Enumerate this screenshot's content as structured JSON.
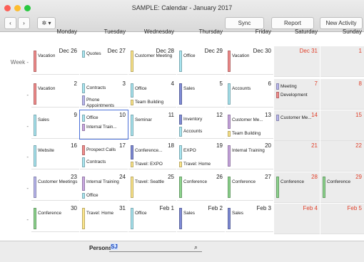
{
  "title": "SAMPLE: Calendar - January 2017",
  "toolbar": {
    "sync": "Sync",
    "report": "Report",
    "new_activity": "New Activity"
  },
  "week_label": "Week -",
  "days": [
    "Monday",
    "Tuesday",
    "Wednesday",
    "Thursday",
    "Friday",
    "Saturday",
    "Sunday"
  ],
  "colors": {
    "pink": "#f28c8c",
    "cyan": "#a8e4ef",
    "yellow": "#fbe58a",
    "blue": "#7f8bd6",
    "purple": "#c9a6e0",
    "green": "#8dd38d",
    "orange": "#f4a261",
    "red": "#e0402a",
    "lavender": "#b8b6ec"
  },
  "weeks": [
    [
      {
        "d": "Dec 26",
        "ev": [
          {
            "t": "Vacation",
            "c": "pink",
            "h": 30
          }
        ]
      },
      {
        "d": "Dec 27",
        "ev": [
          {
            "t": "Quotes",
            "c": "cyan",
            "h": 10
          }
        ]
      },
      {
        "d": "Dec 28",
        "ev": [
          {
            "t": "Customer Meeting",
            "c": "yellow",
            "h": 30
          }
        ]
      },
      {
        "d": "Dec 29",
        "ev": [
          {
            "t": "Office",
            "c": "cyan",
            "h": 30
          }
        ]
      },
      {
        "d": "Dec 30",
        "ev": [
          {
            "t": "Vacation",
            "c": "pink",
            "h": 30
          }
        ]
      },
      {
        "d": "Dec 31",
        "red": true,
        "ev": []
      },
      {
        "d": "1",
        "ev": []
      }
    ],
    [
      {
        "d": "2",
        "ev": [
          {
            "t": "Vacation",
            "c": "pink",
            "h": 30
          }
        ]
      },
      {
        "d": "3",
        "ev": [
          {
            "t": "Contracts",
            "c": "cyan",
            "h": 14
          },
          {
            "t": "Phone Appointments",
            "c": "lavender",
            "h": 14
          }
        ]
      },
      {
        "d": "4",
        "ev": [
          {
            "t": "Office",
            "c": "cyan",
            "h": 20
          },
          {
            "t": "Team Building",
            "c": "yellow",
            "h": 8
          }
        ]
      },
      {
        "d": "5",
        "ev": [
          {
            "t": "Sales",
            "c": "blue",
            "h": 30
          }
        ]
      },
      {
        "d": "6",
        "ev": [
          {
            "t": "Accounts",
            "c": "cyan",
            "h": 30
          }
        ]
      },
      {
        "d": "7",
        "ev": [
          {
            "t": "Meeting",
            "c": "lavender",
            "h": 9
          },
          {
            "t": "Development",
            "c": "pink",
            "h": 9
          }
        ]
      },
      {
        "d": "8",
        "ev": []
      }
    ],
    [
      {
        "d": "9",
        "ev": [
          {
            "t": "Sales",
            "c": "cyan",
            "h": 30
          }
        ]
      },
      {
        "d": "10",
        "sel": true,
        "ev": [
          {
            "t": "Office",
            "c": "cyan",
            "h": 10
          },
          {
            "t": "Internal Train...",
            "c": "purple",
            "h": 10
          }
        ]
      },
      {
        "d": "11",
        "ev": [
          {
            "t": "Seminar",
            "c": "cyan",
            "h": 30
          }
        ]
      },
      {
        "d": "12",
        "ev": [
          {
            "t": "Inventory",
            "c": "blue",
            "h": 14
          },
          {
            "t": "Accounts",
            "c": "cyan",
            "h": 14
          }
        ]
      },
      {
        "d": "13",
        "ev": [
          {
            "t": "Customer Me...",
            "c": "purple",
            "h": 20
          },
          {
            "t": "Team Building",
            "c": "yellow",
            "h": 8
          }
        ]
      },
      {
        "d": "14",
        "ev": [
          {
            "t": "Customer Me...",
            "c": "lavender",
            "h": 9
          }
        ]
      },
      {
        "d": "15",
        "ev": []
      }
    ],
    [
      {
        "d": "16",
        "ev": [
          {
            "t": "Website",
            "c": "cyan",
            "h": 30
          }
        ]
      },
      {
        "d": "17",
        "ev": [
          {
            "t": "Prospect Calls",
            "c": "pink",
            "h": 14
          },
          {
            "t": "Contracts",
            "c": "cyan",
            "h": 14
          }
        ]
      },
      {
        "d": "18",
        "ev": [
          {
            "t": "Conference...",
            "c": "blue",
            "h": 20
          },
          {
            "t": "Travel: EXPO",
            "c": "yellow",
            "h": 8
          }
        ]
      },
      {
        "d": "19",
        "ev": [
          {
            "t": "EXPO",
            "c": "cyan",
            "h": 20
          },
          {
            "t": "Travel: Home",
            "c": "yellow",
            "h": 8
          }
        ]
      },
      {
        "d": "20",
        "ev": [
          {
            "t": "Internal Training",
            "c": "purple",
            "h": 30
          }
        ]
      },
      {
        "d": "21",
        "ev": []
      },
      {
        "d": "22",
        "ev": []
      }
    ],
    [
      {
        "d": "23",
        "ev": [
          {
            "t": "Customer Meetings",
            "c": "lavender",
            "h": 30
          }
        ]
      },
      {
        "d": "24",
        "ev": [
          {
            "t": "Internal Training",
            "c": "purple",
            "h": 20
          },
          {
            "t": "Office",
            "c": "cyan",
            "h": 8
          }
        ]
      },
      {
        "d": "25",
        "ev": [
          {
            "t": "Travel: Seattle",
            "c": "yellow",
            "h": 30
          }
        ]
      },
      {
        "d": "26",
        "ev": [
          {
            "t": "Conference",
            "c": "green",
            "h": 30
          }
        ]
      },
      {
        "d": "27",
        "ev": [
          {
            "t": "Conference",
            "c": "green",
            "h": 30
          }
        ]
      },
      {
        "d": "28",
        "ev": [
          {
            "t": "Conference",
            "c": "green",
            "h": 30
          }
        ]
      },
      {
        "d": "29",
        "ev": [
          {
            "t": "Conference",
            "c": "green",
            "h": 30
          }
        ]
      }
    ],
    [
      {
        "d": "30",
        "ev": [
          {
            "t": "Conference",
            "c": "green",
            "h": 30
          }
        ]
      },
      {
        "d": "31",
        "ev": [
          {
            "t": "Travel: Home",
            "c": "yellow",
            "h": 30
          }
        ]
      },
      {
        "d": "Feb 1",
        "ev": [
          {
            "t": "Office",
            "c": "cyan",
            "h": 30
          }
        ]
      },
      {
        "d": "Feb 2",
        "ev": [
          {
            "t": "Sales",
            "c": "blue",
            "h": 30
          }
        ]
      },
      {
        "d": "Feb 3",
        "ev": [
          {
            "t": "Sales",
            "c": "blue",
            "h": 30
          }
        ]
      },
      {
        "d": "Feb 4",
        "red": true,
        "ev": []
      },
      {
        "d": "Feb 5",
        "red": true,
        "ev": []
      }
    ]
  ],
  "persons": {
    "label": "Persons",
    "value": "SJ"
  }
}
